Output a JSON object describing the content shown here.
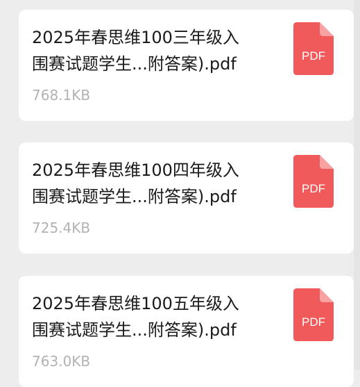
{
  "files": [
    {
      "name_line1": "2025年春思维100三年级入",
      "name_line2": "围赛试题学生...附答案).pdf",
      "size": "768.1KB",
      "icon": "pdf-file-icon",
      "icon_label": "PDF"
    },
    {
      "name_line1": "2025年春思维100四年级入",
      "name_line2": "围赛试题学生...附答案).pdf",
      "size": "725.4KB",
      "icon": "pdf-file-icon",
      "icon_label": "PDF"
    },
    {
      "name_line1": "2025年春思维100五年级入",
      "name_line2": "围赛试题学生...附答案).pdf",
      "size": "763.0KB",
      "icon": "pdf-file-icon",
      "icon_label": "PDF"
    }
  ],
  "colors": {
    "background": "#ededed",
    "card": "#ffffff",
    "pdf_icon": "#f05a5a",
    "pdf_icon_fold": "#f8a3a3",
    "file_name": "#1a1a1a",
    "file_size": "#b2b2b2"
  }
}
